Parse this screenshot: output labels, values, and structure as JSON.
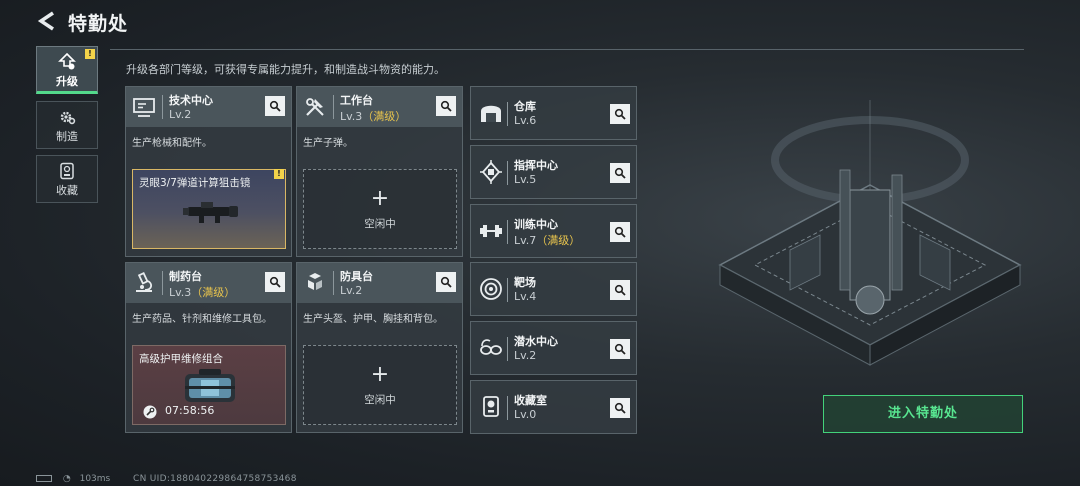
{
  "header": {
    "title": "特勤处"
  },
  "description": "升级各部门等级，可获得专属能力提升，和制造战斗物资的能力。",
  "nav": [
    {
      "label": "升级",
      "icon": "upgrade-icon",
      "active": true,
      "badge": "!"
    },
    {
      "label": "制造",
      "icon": "gear-icon",
      "active": false
    },
    {
      "label": "收藏",
      "icon": "collection-icon",
      "active": false
    }
  ],
  "cards": [
    {
      "name": "技术中心",
      "level": "Lv.2",
      "max": "",
      "icon": "monitor-icon",
      "desc": "生产枪械和配件。",
      "slot": {
        "type": "item",
        "title": "灵眼3/7弹道计算狙击镜",
        "badge": "!"
      }
    },
    {
      "name": "工作台",
      "level": "Lv.3",
      "max": "（满级）",
      "icon": "tools-icon",
      "desc": "生产子弹。",
      "slot": {
        "type": "idle",
        "plus": "+",
        "label": "空闲中"
      }
    },
    {
      "name": "制药台",
      "level": "Lv.3",
      "max": "（满级）",
      "icon": "microscope-icon",
      "desc": "生产药品、针剂和维修工具包。",
      "slot": {
        "type": "item",
        "title": "高级护甲维修组合",
        "timer": "07:58:56"
      }
    },
    {
      "name": "防具台",
      "level": "Lv.2",
      "max": "",
      "icon": "armor-icon",
      "desc": "生产头盔、护甲、胸挂和背包。",
      "slot": {
        "type": "idle",
        "plus": "+",
        "label": "空闲中"
      }
    }
  ],
  "small_cards": [
    {
      "name": "仓库",
      "level": "Lv.6",
      "max": "",
      "icon": "warehouse-icon"
    },
    {
      "name": "指挥中心",
      "level": "Lv.5",
      "max": "",
      "icon": "chip-icon"
    },
    {
      "name": "训练中心",
      "level": "Lv.7",
      "max": "（满级）",
      "icon": "dumbbell-icon"
    },
    {
      "name": "靶场",
      "level": "Lv.4",
      "max": "",
      "icon": "target-icon"
    },
    {
      "name": "潜水中心",
      "level": "Lv.2",
      "max": "",
      "icon": "goggles-icon"
    },
    {
      "name": "收藏室",
      "level": "Lv.0",
      "max": "",
      "icon": "trophy-icon"
    }
  ],
  "enter_button": "进入特勤处",
  "status": {
    "ping": "103ms",
    "uid": "CN UID:18804022986475875346​8"
  },
  "colors": {
    "accent_green": "#53d98b",
    "max_level": "#e8c44d",
    "badge": "#f3d34a"
  }
}
